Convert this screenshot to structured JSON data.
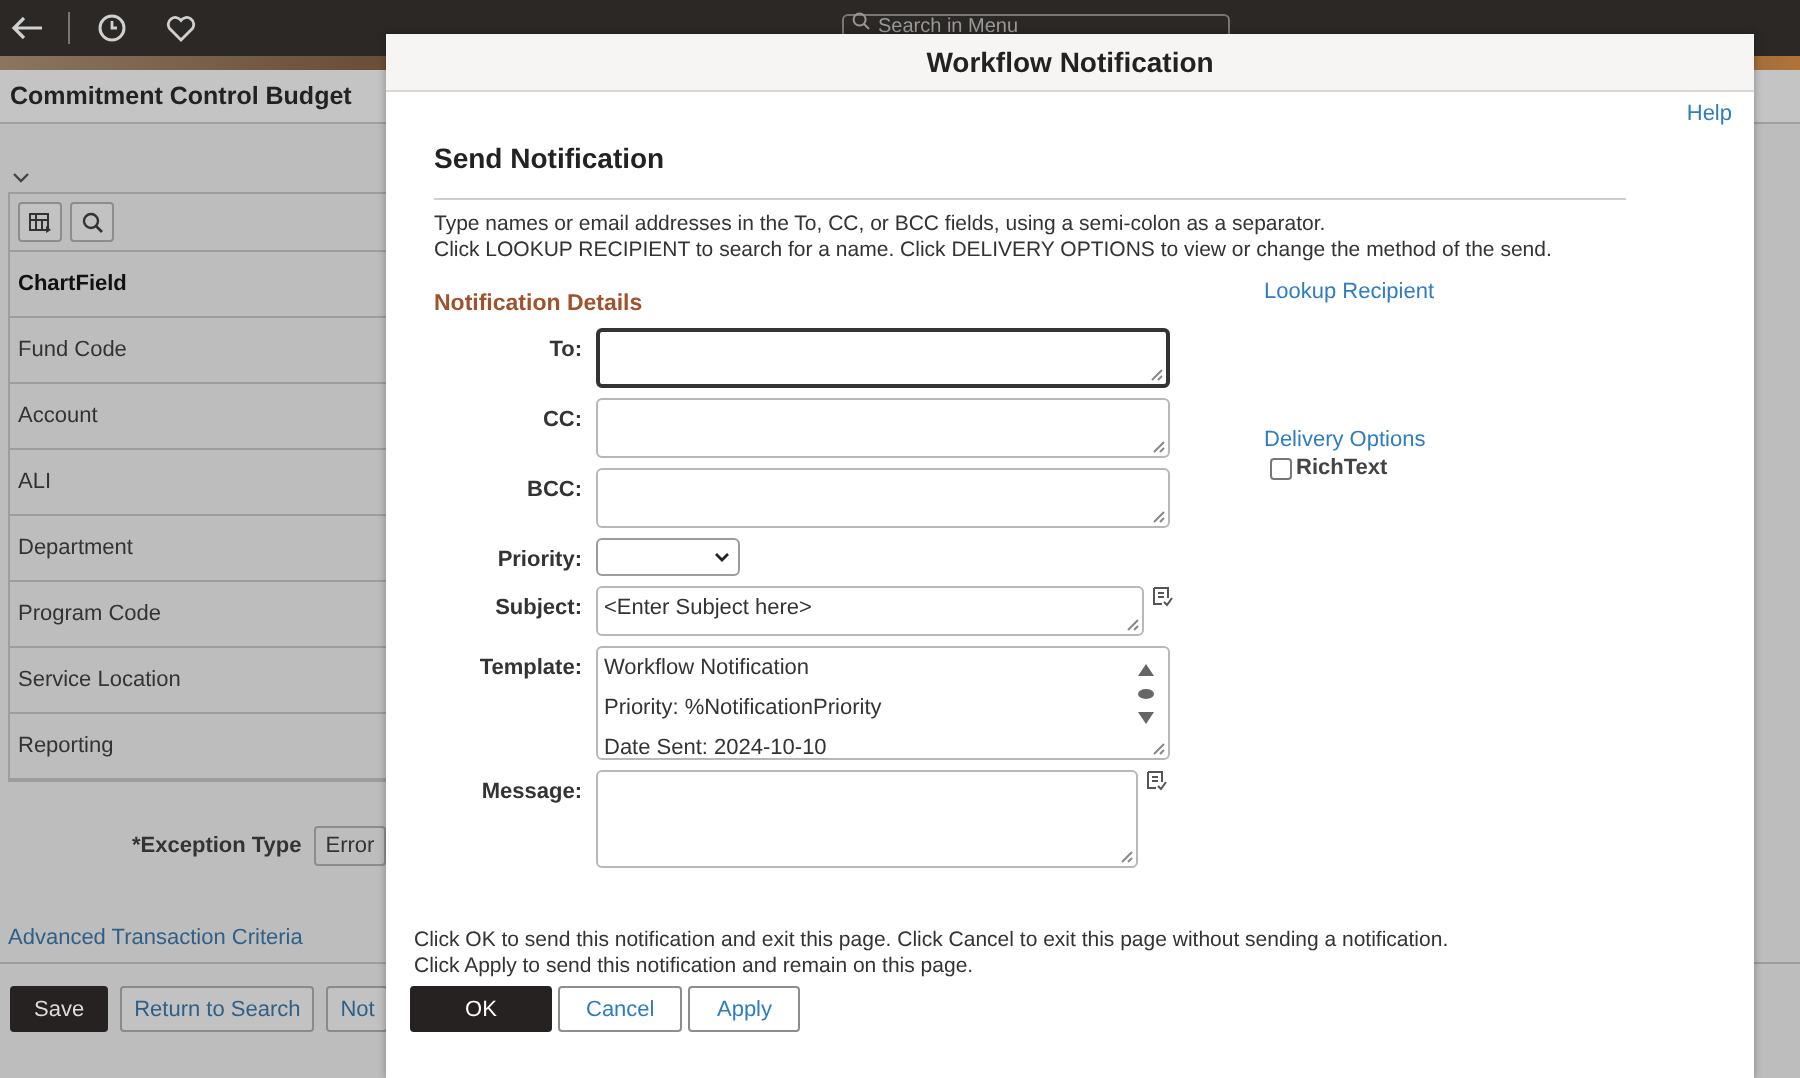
{
  "top_bar": {
    "search": {
      "placeholder": "Search in Menu"
    }
  },
  "page": {
    "title": "Commitment Control Budget",
    "grid": {
      "header": "ChartField",
      "rows": [
        "Fund Code",
        "Account",
        "ALI",
        "Department",
        "Program Code",
        "Service Location",
        "Reporting"
      ]
    },
    "exception_type": {
      "label": "*Exception Type",
      "value": "Error"
    },
    "link": "Advanced Transaction Criteria",
    "buttons": [
      {
        "label": "Save",
        "kind": "primary"
      },
      {
        "label": "Return to Search",
        "kind": "secondary"
      },
      {
        "label": "Not",
        "kind": "secondary"
      }
    ]
  },
  "dialog": {
    "title": "Workflow Notification",
    "help": "Help",
    "heading": "Send Notification",
    "instructions": [
      "Type names or email addresses in the To, CC, or BCC fields, using a semi-colon as a separator.",
      "Click LOOKUP RECIPIENT to search for a name.  Click DELIVERY OPTIONS to view or change the method of the send."
    ],
    "section": "Notification Details",
    "lookup_link": "Lookup Recipient",
    "delivery_link": "Delivery Options",
    "rich_text": {
      "label": "RichText",
      "checked": false
    },
    "fields": [
      {
        "label": "To:",
        "kind": "textarea",
        "focused": true
      },
      {
        "label": "CC:",
        "kind": "textarea",
        "focused": false
      },
      {
        "label": "BCC:",
        "kind": "textarea",
        "focused": false
      },
      {
        "label": "Priority:",
        "kind": "select",
        "focused": false
      },
      {
        "label": "Subject:",
        "kind": "textarea",
        "focused": false,
        "value": "<Enter Subject here>",
        "spell_check": true
      },
      {
        "label": "Template:",
        "kind": "template",
        "focused": false,
        "lines": [
          "Workflow Notification",
          "Priority:  %NotificationPriority",
          "Date Sent:  2024-10-10"
        ]
      },
      {
        "label": "Message:",
        "kind": "textarea",
        "focused": false,
        "spell_check": true
      }
    ],
    "footer": [
      "Click OK to send this notification and exit this page.  Click Cancel to exit this page without sending a notification.",
      "Click Apply to send this notification and remain on this page."
    ],
    "buttons": [
      {
        "label": "OK",
        "kind": "primary"
      },
      {
        "label": "Cancel",
        "kind": "secondary"
      },
      {
        "label": "Apply",
        "kind": "secondary"
      }
    ]
  }
}
